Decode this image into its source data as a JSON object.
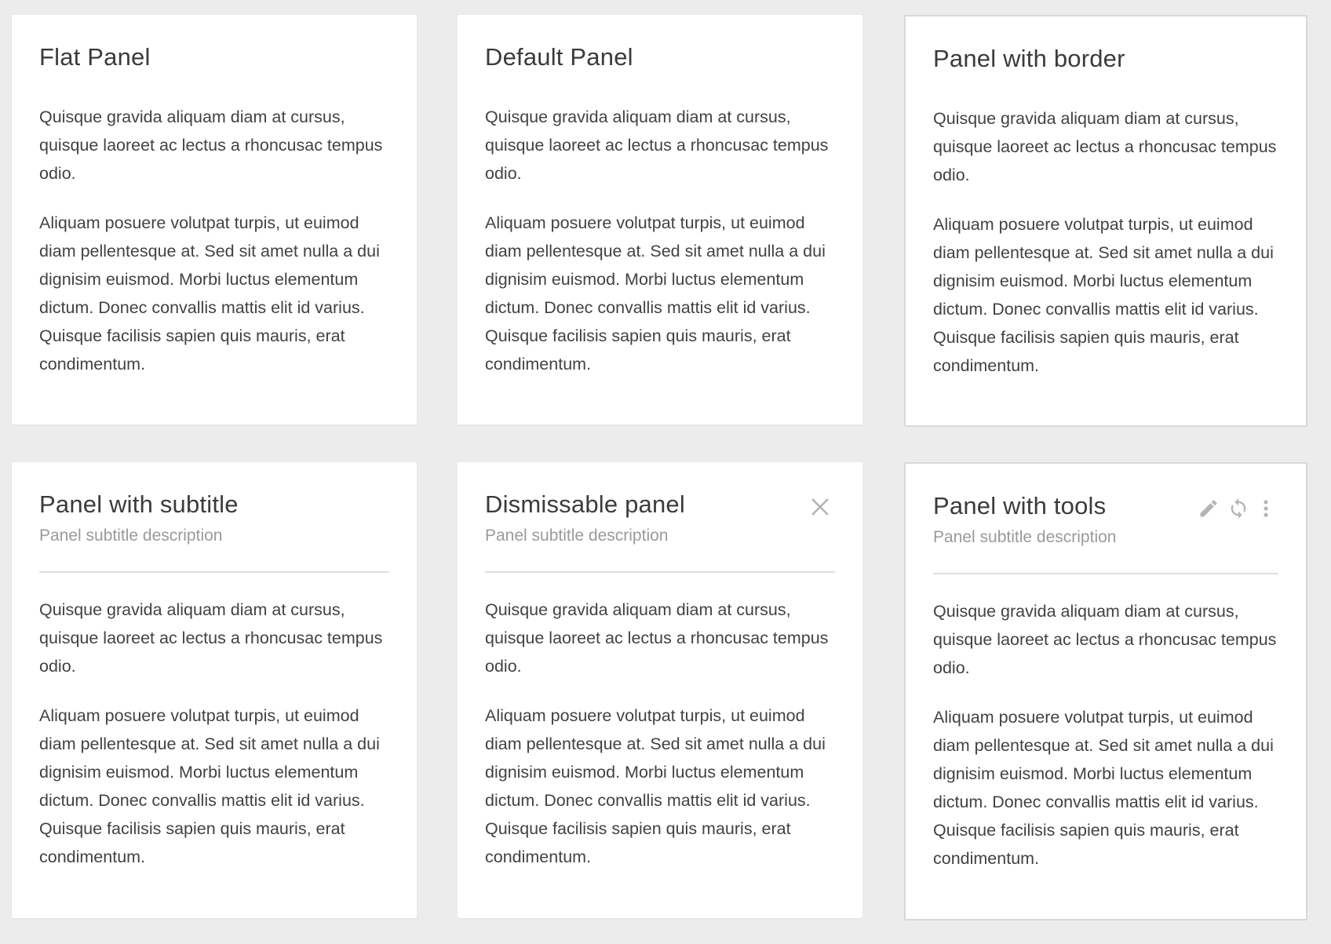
{
  "panels": [
    {
      "title": "Flat Panel",
      "paragraphs": [
        "Quisque gravida aliquam diam at cursus, quisque laoreet ac lectus a rhoncusac tempus odio.",
        "Aliquam posuere volutpat turpis, ut euimod diam pellentesque at. Sed sit amet nulla a dui dignisim euismod. Morbi luctus elementum dictum. Donec convallis mattis elit id varius. Quisque facilisis sapien quis mauris, erat condimentum."
      ]
    },
    {
      "title": "Default Panel",
      "paragraphs": [
        "Quisque gravida aliquam diam at cursus, quisque laoreet ac lectus a rhoncusac tempus odio.",
        "Aliquam posuere volutpat turpis, ut euimod diam pellentesque at. Sed sit amet nulla a dui dignisim euismod. Morbi luctus elementum dictum. Donec convallis mattis elit id varius. Quisque facilisis sapien quis mauris, erat condimentum."
      ]
    },
    {
      "title": "Panel with border",
      "paragraphs": [
        "Quisque gravida aliquam diam at cursus, quisque laoreet ac lectus a rhoncusac tempus odio.",
        "Aliquam posuere volutpat turpis, ut euimod diam pellentesque at. Sed sit amet nulla a dui dignisim euismod. Morbi luctus elementum dictum. Donec convallis mattis elit id varius. Quisque facilisis sapien quis mauris, erat condimentum."
      ]
    },
    {
      "title": "Panel with subtitle",
      "subtitle": "Panel subtitle description",
      "paragraphs": [
        "Quisque gravida aliquam diam at cursus, quisque laoreet ac lectus a rhoncusac tempus odio.",
        "Aliquam posuere volutpat turpis, ut euimod diam pellentesque at. Sed sit amet nulla a dui dignisim euismod. Morbi luctus elementum dictum. Donec convallis mattis elit id varius. Quisque facilisis sapien quis mauris, erat condimentum."
      ]
    },
    {
      "title": "Dismissable panel",
      "subtitle": "Panel subtitle description",
      "paragraphs": [
        "Quisque gravida aliquam diam at cursus, quisque laoreet ac lectus a rhoncusac tempus odio.",
        "Aliquam posuere volutpat turpis, ut euimod diam pellentesque at. Sed sit amet nulla a dui dignisim euismod. Morbi luctus elementum dictum. Donec convallis mattis elit id varius. Quisque facilisis sapien quis mauris, erat condimentum."
      ],
      "tools": [
        "close-icon"
      ]
    },
    {
      "title": "Panel with tools",
      "subtitle": "Panel subtitle description",
      "paragraphs": [
        "Quisque gravida aliquam diam at cursus, quisque laoreet ac lectus a rhoncusac tempus odio.",
        "Aliquam posuere volutpat turpis, ut euimod diam pellentesque at. Sed sit amet nulla a dui dignisim euismod. Morbi luctus elementum dictum. Donec convallis mattis elit id varius. Quisque facilisis sapien quis mauris, erat condimentum."
      ],
      "tools": [
        "pencil-icon",
        "refresh-icon",
        "more-vertical-icon"
      ]
    }
  ],
  "colors": {
    "page_background": "#ececec",
    "panel_background": "#ffffff",
    "title_text": "#3b3b3b",
    "body_text": "#424242",
    "subtitle_text": "#9a9a9a",
    "icon": "#b5b5b5",
    "border": "#d9d9d9"
  }
}
